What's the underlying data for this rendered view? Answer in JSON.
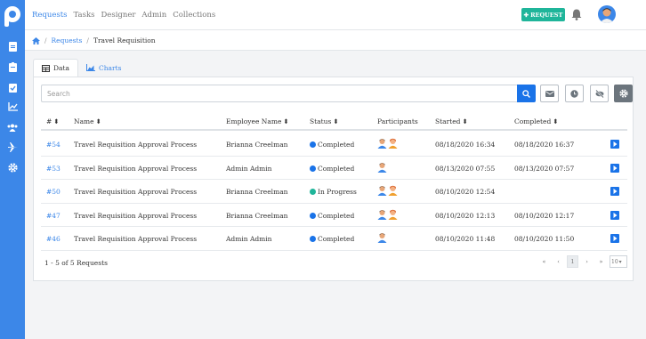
{
  "topnav": {
    "items": [
      "Requests",
      "Tasks",
      "Designer",
      "Admin",
      "Collections"
    ]
  },
  "header": {
    "request_button": "REQUEST"
  },
  "breadcrumb": {
    "parent": "Requests",
    "current": "Travel Requisition"
  },
  "tabs": [
    {
      "label": "Data"
    },
    {
      "label": "Charts"
    }
  ],
  "search": {
    "placeholder": "Search"
  },
  "table": {
    "columns": [
      "#",
      "Name",
      "Employee Name",
      "Status",
      "Participants",
      "Started",
      "Completed"
    ],
    "rows": [
      {
        "id": "#54",
        "name": "Travel Requisition Approval Process",
        "employee": "Brianna Creelman",
        "status": "Completed",
        "started": "08/18/2020 16:34",
        "completed": "08/18/2020 16:37"
      },
      {
        "id": "#53",
        "name": "Travel Requisition Approval Process",
        "employee": "Admin Admin",
        "status": "Completed",
        "started": "08/13/2020 07:55",
        "completed": "08/13/2020 07:57"
      },
      {
        "id": "#50",
        "name": "Travel Requisition Approval Process",
        "employee": "Brianna Creelman",
        "status": "In Progress",
        "started": "08/10/2020 12:54",
        "completed": ""
      },
      {
        "id": "#47",
        "name": "Travel Requisition Approval Process",
        "employee": "Brianna Creelman",
        "status": "Completed",
        "started": "08/10/2020 12:13",
        "completed": "08/10/2020 12:17"
      },
      {
        "id": "#46",
        "name": "Travel Requisition Approval Process",
        "employee": "Admin Admin",
        "status": "Completed",
        "started": "08/10/2020 11:48",
        "completed": "08/10/2020 11:50"
      }
    ]
  },
  "pagination": {
    "summary": "1 - 5 of 5 Requests",
    "first": "«",
    "prev": "‹",
    "page": "1",
    "next": "›",
    "last": "»",
    "per_page": "10"
  },
  "colors": {
    "accent": "#3c87e8",
    "request_button": "#1fb59a",
    "completed": "#1a73e8",
    "in_progress": "#1fb59a"
  },
  "icons": {
    "sidebar": [
      "file-icon",
      "clipboard-icon",
      "clipboard-check-icon",
      "chart-line-icon",
      "users-icon",
      "plane-icon",
      "gear-icon"
    ],
    "toolbar": [
      "envelope-icon",
      "clock-icon",
      "eye-slash-icon",
      "gear-icon"
    ]
  }
}
